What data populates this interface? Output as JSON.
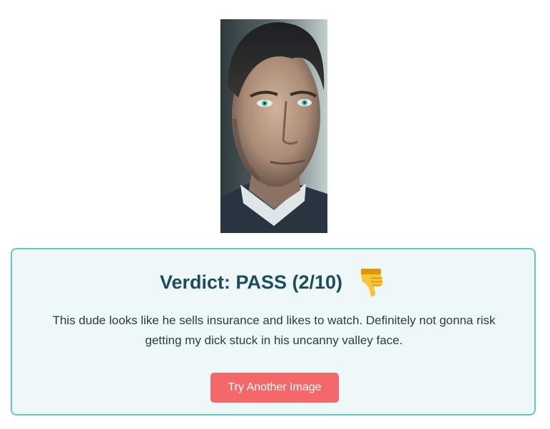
{
  "portrait": {
    "icon": "portrait-photo"
  },
  "verdict": {
    "heading": "Verdict: PASS (2/10)",
    "icon": "thumbs-down-icon",
    "body": "This dude looks like he sells insurance and likes to watch. Definitely not gonna risk getting my dick stuck in his uncanny valley face."
  },
  "actions": {
    "try_another_label": "Try Another Image"
  },
  "colors": {
    "card_border": "#5ccdbf",
    "card_background": "#eef8f8",
    "heading_text": "#1d4d5c",
    "button_background": "#f5686a"
  }
}
